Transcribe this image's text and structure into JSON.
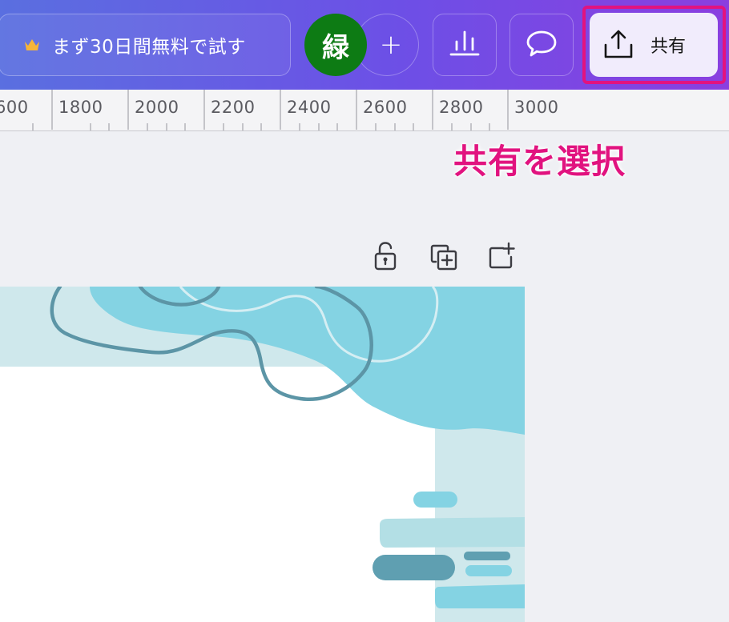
{
  "topbar": {
    "trial_label": "まず30日間無料で試す",
    "avatar_initial": "緑",
    "add_label": "+",
    "share_label": "共有",
    "icons": {
      "trial": "crown-icon",
      "insights": "bar-chart-icon",
      "comment": "speech-bubble-icon",
      "share": "upload-icon"
    },
    "colors": {
      "avatar": "#0d7b14",
      "highlight": "#e2137f",
      "share_bg": "#f1ecfc"
    }
  },
  "ruler": {
    "labels": [
      "600",
      "1800",
      "2000",
      "2200",
      "2400",
      "2600",
      "2800",
      "3000"
    ]
  },
  "callout": {
    "text": "共有を選択",
    "color": "#e1137f"
  },
  "page_tools": {
    "icons": [
      "lock-icon",
      "duplicate-page-icon",
      "add-page-icon"
    ]
  }
}
